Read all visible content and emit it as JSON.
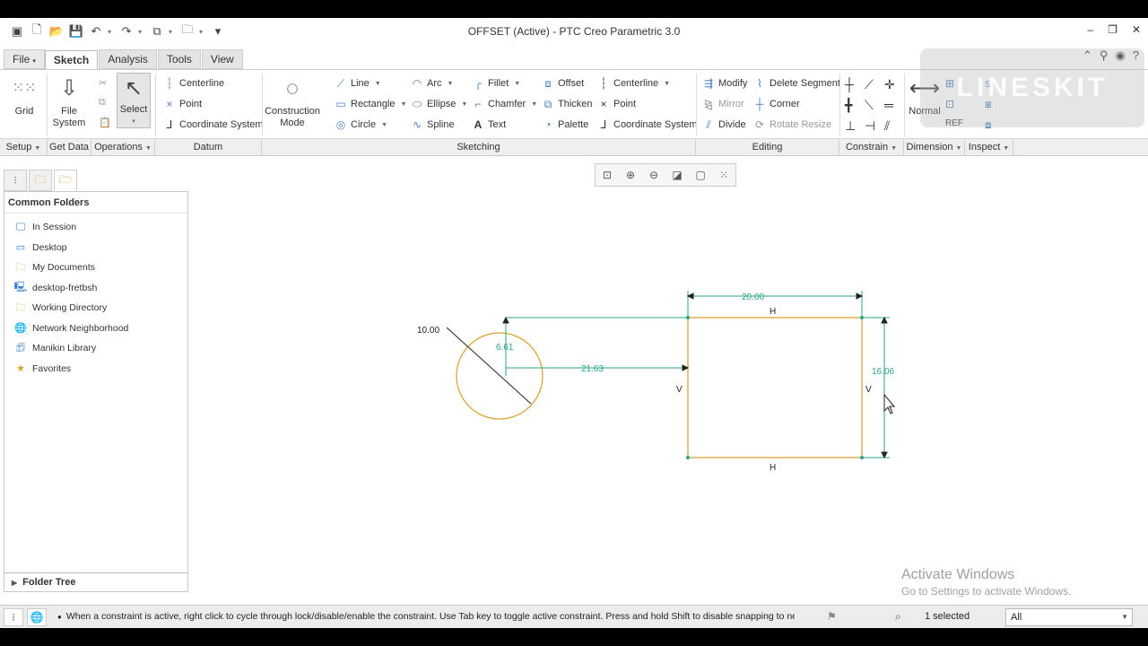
{
  "window": {
    "title": "OFFSET (Active) - PTC Creo Parametric 3.0",
    "controls": [
      "–",
      "❐",
      "✕"
    ]
  },
  "tabs": [
    {
      "label": "File"
    },
    {
      "label": "Sketch"
    },
    {
      "label": "Analysis"
    },
    {
      "label": "Tools"
    },
    {
      "label": "View"
    }
  ],
  "ribbon": {
    "grid": "Grid",
    "file_system": [
      "File",
      "System"
    ],
    "select": "Select",
    "datum": {
      "centerline": "Centerline",
      "point": "Point",
      "coordinate_system": "Coordinate System"
    },
    "construction_mode": [
      "Construction",
      "Mode"
    ],
    "sketching": {
      "line": "Line",
      "rectangle": "Rectangle",
      "circle": "Circle",
      "arc": "Arc",
      "ellipse": "Ellipse",
      "spline": "Spline",
      "fillet": "Fillet",
      "chamfer": "Chamfer",
      "text": "Text",
      "offset": "Offset",
      "thicken": "Thicken",
      "palette": "Palette",
      "centerline": "Centerline",
      "point": "Point",
      "coordinate_system": "Coordinate System"
    },
    "editing": {
      "modify": "Modify",
      "mirror": "Mirror",
      "divide": "Divide",
      "delete_segment": "Delete Segment",
      "corner": "Corner",
      "rotate_resize": "Rotate Resize"
    },
    "normal": "Normal"
  },
  "groups": [
    {
      "label": "Setup",
      "dropdown": true
    },
    {
      "label": "Get Data",
      "dropdown": false
    },
    {
      "label": "Operations",
      "dropdown": true
    },
    {
      "label": "Datum",
      "dropdown": false
    },
    {
      "label": "Sketching",
      "dropdown": false
    },
    {
      "label": "Editing",
      "dropdown": false
    },
    {
      "label": "Constrain",
      "dropdown": true
    },
    {
      "label": "Dimension",
      "dropdown": true
    },
    {
      "label": "Inspect",
      "dropdown": true
    }
  ],
  "navigator": {
    "header": "Common Folders",
    "items": [
      {
        "label": "In Session",
        "icon": "monitor-icon"
      },
      {
        "label": "Desktop",
        "icon": "desktop-icon"
      },
      {
        "label": "My Documents",
        "icon": "documents-icon"
      },
      {
        "label": "desktop-fretbsh",
        "icon": "computer-icon"
      },
      {
        "label": "Working Directory",
        "icon": "folder-icon"
      },
      {
        "label": "Network Neighborhood",
        "icon": "network-icon"
      },
      {
        "label": "Manikin Library",
        "icon": "library-icon"
      },
      {
        "label": "Favorites",
        "icon": "favorites-icon"
      }
    ],
    "folder_tree": "Folder Tree"
  },
  "sketch": {
    "dimensions": {
      "width": "20.00",
      "height": "16.06",
      "circle_diameter": "10.00",
      "vertical_offset": "6.61",
      "horizontal_offset": "21.63"
    },
    "constraints": {
      "horizontal": "H",
      "vertical": "V"
    },
    "colors": {
      "geometry": "#d9a534",
      "dimension": "#2aa58a",
      "constraint": "#222222"
    }
  },
  "watermark": "LINESKIT",
  "activation": {
    "line1": "Activate Windows",
    "line2": "Go to Settings to activate Windows."
  },
  "status": {
    "message": "When a constraint is active, right click to cycle through lock/disable/enable the constraint. Use Tab key to toggle active constraint. Press and hold Shift to disable snapping to new c",
    "selected": "1 selected",
    "filter": "All"
  }
}
